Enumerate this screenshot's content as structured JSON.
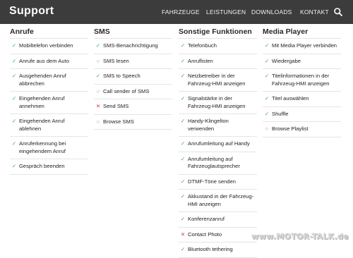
{
  "header": {
    "brand": "Support",
    "nav": [
      "FAHRZEUGE",
      "LEISTUNGEN",
      "DOWNLOADS",
      "KONTAKT"
    ],
    "search_icon": "search-icon"
  },
  "columns": [
    {
      "title": "Anrufe",
      "items": [
        {
          "label": "Mobiltelefon verbinden",
          "status": "check"
        },
        {
          "label": "Anrufe aus dem Auto",
          "status": "check"
        },
        {
          "label": "Ausgehenden Anruf abbrechen",
          "status": "check"
        },
        {
          "label": "Eingehenden Anruf annehmen",
          "status": "check"
        },
        {
          "label": "Eingehenden Anruf ablehnen",
          "status": "check"
        },
        {
          "label": "Anruferkennung bei eingehendem Anruf",
          "status": "check"
        },
        {
          "label": "Gespräch beenden",
          "status": "check"
        }
      ]
    },
    {
      "title": "SMS",
      "items": [
        {
          "label": "SMS-Benachrichtigung",
          "status": "check"
        },
        {
          "label": "SMS lesen",
          "status": "circle"
        },
        {
          "label": "SMS to Speech",
          "status": "check"
        },
        {
          "label": "Call sender of SMS",
          "status": "circle"
        },
        {
          "label": "Send SMS",
          "status": "cross"
        },
        {
          "label": "Browse SMS",
          "status": "circle"
        }
      ]
    },
    {
      "title": "Sonstige Funktionen",
      "items": [
        {
          "label": "Telefonbuch",
          "status": "check"
        },
        {
          "label": "Anruflisten",
          "status": "check"
        },
        {
          "label": "Netzbetreiber in der Fahrzeug-HMI anzeigen",
          "status": "check"
        },
        {
          "label": "Signalstärke in der Fahrzeug-HMI anzeigen",
          "status": "check"
        },
        {
          "label": "Handy-Klingelton verwenden",
          "status": "check"
        },
        {
          "label": "Anrufumleitung auf Handy",
          "status": "check"
        },
        {
          "label": "Anrufumleitung auf Fahrzeuglautsprecher",
          "status": "check"
        },
        {
          "label": "DTMF-Töne senden",
          "status": "check"
        },
        {
          "label": "Akkustand in der Fahrzeug-HMI anzeigen",
          "status": "check"
        },
        {
          "label": "Konferenzanruf",
          "status": "check"
        },
        {
          "label": "Contact Photo",
          "status": "cross"
        },
        {
          "label": "Bluetooth tethering",
          "status": "check"
        }
      ]
    },
    {
      "title": "Media Player",
      "items": [
        {
          "label": "Mit Media Player verbinden",
          "status": "check"
        },
        {
          "label": "Wiedergabe",
          "status": "check"
        },
        {
          "label": "Titelinformationen in der Fahrzeug-HMI anzeigen",
          "status": "check"
        },
        {
          "label": "Titel auswählen",
          "status": "check"
        },
        {
          "label": "Shuffle",
          "status": "check"
        },
        {
          "label": "Browse Playlist",
          "status": "circle"
        }
      ]
    }
  ],
  "status_glyphs": {
    "check": "✓",
    "cross": "✕",
    "circle": "○"
  },
  "colors": {
    "header_bg": "#3c3c3c",
    "check": "#2fa653",
    "cross": "#d93a3a",
    "circle": "#9a9a9a"
  },
  "watermark": "www.MOTOR-TALK.de"
}
